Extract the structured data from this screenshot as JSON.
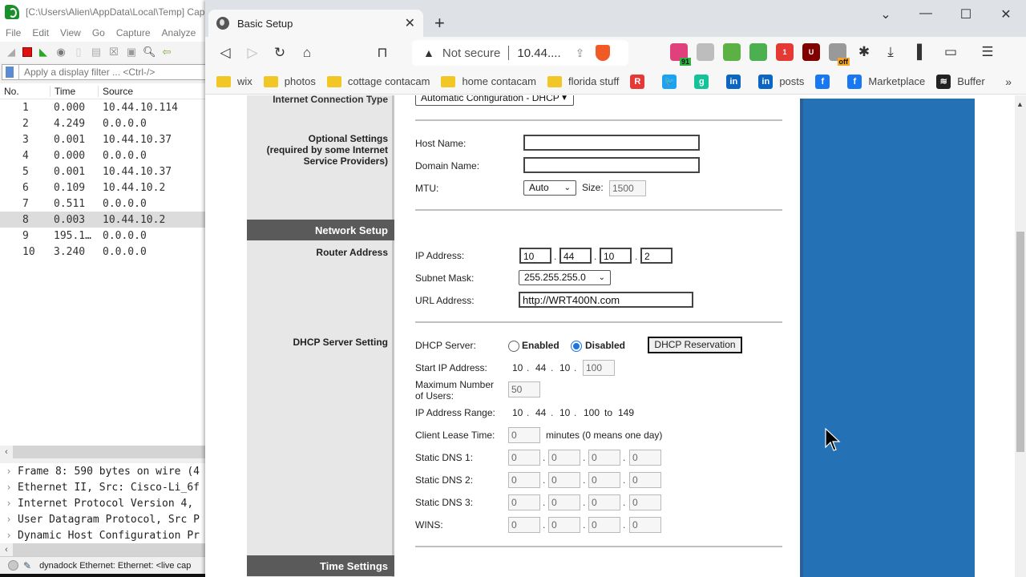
{
  "wireshark": {
    "title": "[C:\\Users\\Alien\\AppData\\Local\\Temp] Cap",
    "menu": [
      "File",
      "Edit",
      "View",
      "Go",
      "Capture",
      "Analyze"
    ],
    "filter_placeholder": "Apply a display filter ... <Ctrl-/>",
    "columns": {
      "no": "No.",
      "time": "Time",
      "source": "Source"
    },
    "packets": [
      {
        "no": "1",
        "time": "0.000",
        "source": "10.44.10.114"
      },
      {
        "no": "2",
        "time": "4.249",
        "source": "0.0.0.0"
      },
      {
        "no": "3",
        "time": "0.001",
        "source": "10.44.10.37"
      },
      {
        "no": "4",
        "time": "0.000",
        "source": "0.0.0.0"
      },
      {
        "no": "5",
        "time": "0.001",
        "source": "10.44.10.37"
      },
      {
        "no": "6",
        "time": "0.109",
        "source": "10.44.10.2"
      },
      {
        "no": "7",
        "time": "0.511",
        "source": "0.0.0.0"
      },
      {
        "no": "8",
        "time": "0.003",
        "source": "10.44.10.2"
      },
      {
        "no": "9",
        "time": "195.1…",
        "source": "0.0.0.0"
      },
      {
        "no": "10",
        "time": "3.240",
        "source": "0.0.0.0"
      }
    ],
    "selected_packet": "8",
    "details": [
      "Frame 8: 590 bytes on wire (4",
      "Ethernet II, Src: Cisco-Li_6f",
      "Internet Protocol Version 4,",
      "User Datagram Protocol, Src P",
      "Dynamic Host Configuration Pr"
    ],
    "status_text": "dynadock Ethernet: Ethernet: <live cap"
  },
  "browser": {
    "tab_title": "Basic Setup",
    "omnibox": {
      "security": "Not secure",
      "url": "10.44...."
    },
    "extensions": [
      {
        "name": "mail-extension",
        "badge": "91",
        "color": "#e0407b",
        "badge_color": "#2fb344"
      },
      {
        "name": "envelope-extension",
        "badge": "",
        "color": "#bdbdbd"
      },
      {
        "name": "print-friendly-extension",
        "badge": "",
        "color": "#5bb143"
      },
      {
        "name": "shield-check-extension",
        "badge": "",
        "color": "#4caf50"
      },
      {
        "name": "shield-one-extension",
        "badge": "1",
        "color": "#e53935"
      },
      {
        "name": "ublock-extension",
        "badge": "U",
        "color": "#800000"
      },
      {
        "name": "cat-extension",
        "badge": "off",
        "color": "#999999",
        "badge_color": "#f5a623"
      }
    ],
    "bookmarks": [
      {
        "type": "folder",
        "label": "wix"
      },
      {
        "type": "folder",
        "label": "photos"
      },
      {
        "type": "folder",
        "label": "cottage contacam"
      },
      {
        "type": "folder",
        "label": "home contacam"
      },
      {
        "type": "folder",
        "label": "florida stuff"
      },
      {
        "type": "site",
        "icon": "R",
        "label": "",
        "color": "#e53935"
      },
      {
        "type": "site",
        "icon": "🐦",
        "label": "",
        "color": "#1da1f2"
      },
      {
        "type": "site",
        "icon": "g",
        "label": "",
        "color": "#15c39a"
      },
      {
        "type": "site",
        "icon": "in",
        "label": "",
        "color": "#0a66c2"
      },
      {
        "type": "site",
        "icon": "in",
        "label": "posts",
        "color": "#0a66c2"
      },
      {
        "type": "site",
        "icon": "f",
        "label": "",
        "color": "#1877f2"
      },
      {
        "type": "site",
        "icon": "f",
        "label": "Marketplace",
        "color": "#1877f2"
      },
      {
        "type": "site",
        "icon": "≋",
        "label": "Buffer",
        "color": "#222222"
      }
    ],
    "more_bookmarks": "»"
  },
  "router": {
    "sections": {
      "internet_connection_type": "Internet Connection Type",
      "optional_settings": "Optional Settings",
      "optional_settings_note1": "(required by some Internet",
      "optional_settings_note2": "Service Providers)",
      "network_setup": "Network Setup",
      "router_address": "Router Address",
      "dhcp_server_setting": "DHCP Server Setting",
      "time_settings": "Time Settings"
    },
    "connection_type_value": "Automatic Configuration - DHCP",
    "host_name": {
      "label": "Host Name:",
      "value": ""
    },
    "domain_name": {
      "label": "Domain Name:",
      "value": ""
    },
    "mtu": {
      "label": "MTU:",
      "value": "Auto",
      "size_label": "Size:",
      "size_value": "1500"
    },
    "ip_address": {
      "label": "IP Address:",
      "octets": [
        "10",
        "44",
        "10",
        "2"
      ]
    },
    "subnet_mask": {
      "label": "Subnet Mask:",
      "value": "255.255.255.0"
    },
    "url_address": {
      "label": "URL Address:",
      "value": "http://WRT400N.com"
    },
    "dhcp_server": {
      "label": "DHCP Server:",
      "enabled_label": "Enabled",
      "disabled_label": "Disabled",
      "selected": "Disabled",
      "reservation_button": "DHCP Reservation"
    },
    "start_ip": {
      "label": "Start IP Address:",
      "prefix": [
        "10",
        "44",
        "10"
      ],
      "last": "100"
    },
    "max_users": {
      "label1": "Maximum Number",
      "label2": "of Users:",
      "value": "50"
    },
    "ip_range": {
      "label": "IP Address Range:",
      "prefix": [
        "10",
        "44",
        "10"
      ],
      "from": "100",
      "to_word": "to",
      "to": "149"
    },
    "lease_time": {
      "label": "Client Lease Time:",
      "value": "0",
      "suffix": "minutes (0 means one day)"
    },
    "dns": [
      {
        "label": "Static DNS 1:",
        "octets": [
          "0",
          "0",
          "0",
          "0"
        ]
      },
      {
        "label": "Static DNS 2:",
        "octets": [
          "0",
          "0",
          "0",
          "0"
        ]
      },
      {
        "label": "Static DNS 3:",
        "octets": [
          "0",
          "0",
          "0",
          "0"
        ]
      },
      {
        "label": "WINS:",
        "octets": [
          "0",
          "0",
          "0",
          "0"
        ]
      }
    ]
  },
  "colors": {
    "side_panel_blue": "#2571b5",
    "section_bar": "#5a5a5a",
    "radio_selected": "#1a73e8"
  }
}
